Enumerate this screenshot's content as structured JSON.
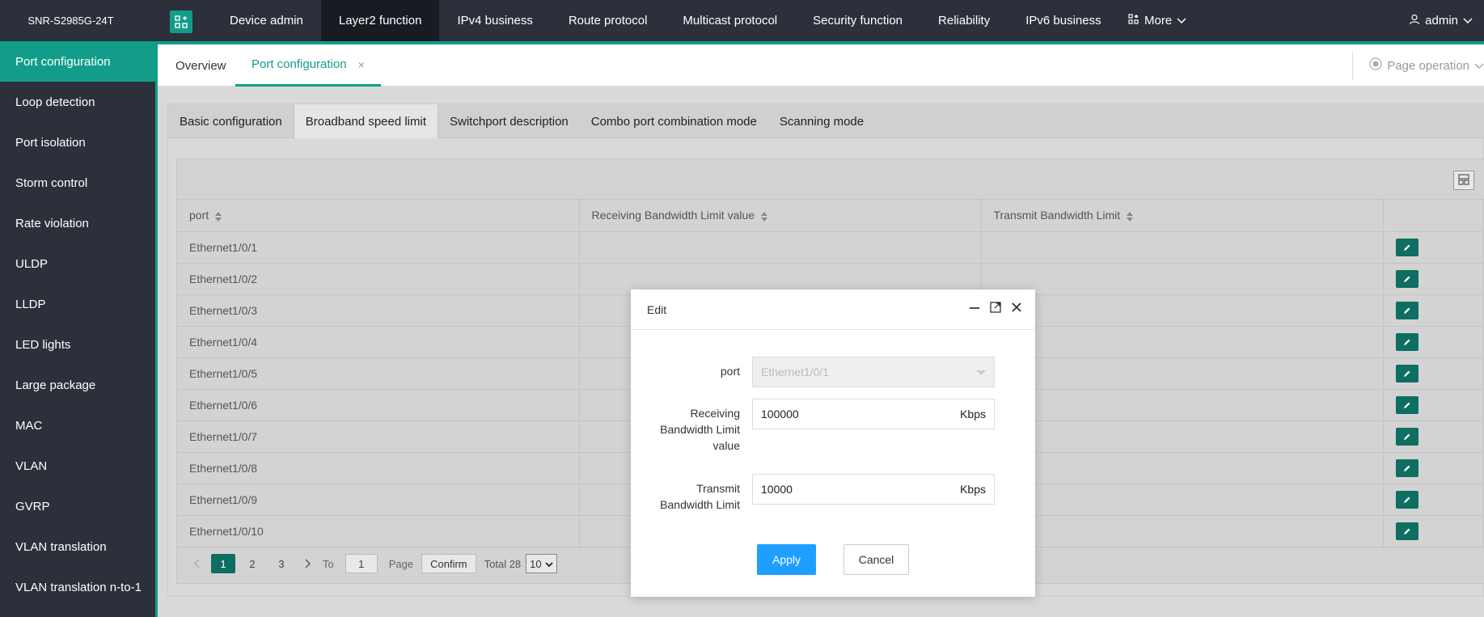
{
  "brand": {
    "model": "SNR-S2985G-24T",
    "icon": "apps-grid-icon"
  },
  "nav": {
    "items": [
      "Device admin",
      "Layer2 function",
      "IPv4 business",
      "Route protocol",
      "Multicast protocol",
      "Security function",
      "Reliability",
      "IPv6 business"
    ],
    "active_index": 1,
    "more_label": "More",
    "user_label": "admin"
  },
  "sidebar": {
    "items": [
      "Port configuration",
      "Loop detection",
      "Port isolation",
      "Storm control",
      "Rate violation",
      "ULDP",
      "LLDP",
      "LED lights",
      "Large package",
      "MAC",
      "VLAN",
      "GVRP",
      "VLAN translation",
      "VLAN translation n-to-1"
    ],
    "active_index": 0
  },
  "tabs": {
    "overview": "Overview",
    "port_config": "Port configuration",
    "close_symbol": "×",
    "page_operation": "Page operation"
  },
  "subtabs": {
    "items": [
      "Basic configuration",
      "Broadband speed limit",
      "Switchport description",
      "Combo port combination mode",
      "Scanning mode"
    ],
    "active_index": 1
  },
  "table": {
    "columns": [
      "port",
      "Receiving Bandwidth Limit value",
      "Transmit Bandwidth Limit"
    ],
    "rows": [
      "Ethernet1/0/1",
      "Ethernet1/0/2",
      "Ethernet1/0/3",
      "Ethernet1/0/4",
      "Ethernet1/0/5",
      "Ethernet1/0/6",
      "Ethernet1/0/7",
      "Ethernet1/0/8",
      "Ethernet1/0/9",
      "Ethernet1/0/10"
    ]
  },
  "pager": {
    "pages": [
      "1",
      "2",
      "3"
    ],
    "to_label": "To",
    "goto_value": "1",
    "page_label": "Page",
    "confirm_label": "Confirm",
    "total_label": "Total 28",
    "page_size": "10"
  },
  "modal": {
    "title": "Edit",
    "port_label": "port",
    "port_value": "Ethernet1/0/1",
    "rx_label_1": "Receiving",
    "rx_label_2": "Bandwidth Limit",
    "rx_label_3": "value",
    "rx_value": "100000",
    "rx_unit": "Kbps",
    "tx_label_1": "Transmit",
    "tx_label_2": "Bandwidth Limit",
    "tx_value": "10000",
    "tx_unit": "Kbps",
    "apply_label": "Apply",
    "cancel_label": "Cancel"
  },
  "colors": {
    "accent": "#129d8b",
    "dark": "#2b303b",
    "primary_button": "#1e9fff",
    "edit_button": "#0e6e62"
  }
}
